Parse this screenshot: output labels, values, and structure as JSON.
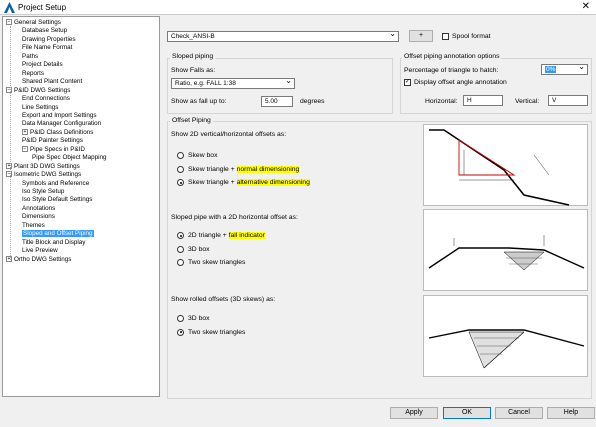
{
  "window": {
    "title": "Project Setup",
    "close_glyph": "✕",
    "app_icon": "autocad-a-icon"
  },
  "tree": [
    {
      "label": "General Settings",
      "exp": "−"
    },
    {
      "label": "Database Setup"
    },
    {
      "label": "Drawing Properties"
    },
    {
      "label": "File Name Format"
    },
    {
      "label": "Paths"
    },
    {
      "label": "Project Details"
    },
    {
      "label": "Reports"
    },
    {
      "label": "Shared Plant Content"
    },
    {
      "label": "P&ID DWG Settings",
      "exp": "−"
    },
    {
      "label": "End Connections"
    },
    {
      "label": "Line Settings"
    },
    {
      "label": "Export and Import Settings"
    },
    {
      "label": "Data Manager Configuration"
    },
    {
      "label": "P&ID Class Definitions",
      "exp": "+"
    },
    {
      "label": "P&ID Painter Settings"
    },
    {
      "label": "Pipe Specs in P&ID",
      "exp": "−"
    },
    {
      "label": "Pipe Spec Object Mapping"
    },
    {
      "label": "Plant 3D DWG Settings",
      "exp": "+"
    },
    {
      "label": "Isometric DWG Settings",
      "exp": "−"
    },
    {
      "label": "Symbols and Reference"
    },
    {
      "label": "Iso Style Setup"
    },
    {
      "label": "Iso Style Default Settings"
    },
    {
      "label": "Annotations"
    },
    {
      "label": "Dimensions"
    },
    {
      "label": "Themes"
    },
    {
      "label": "Sloped and Offset Piping",
      "selected": true
    },
    {
      "label": "Title Block and Display"
    },
    {
      "label": "Live Preview"
    },
    {
      "label": "Ortho DWG Settings",
      "exp": "+"
    }
  ],
  "style_select": {
    "value": "Check_ANSI-B",
    "add_label": "+",
    "spool_format_label": "Spool format"
  },
  "sloped": {
    "group_label": "Sloped piping",
    "show_falls_label": "Show Falls as:",
    "falls_value": "Ratio, e.g. FALL 1:38",
    "fall_up_label": "Show as fall up to:",
    "fall_up_value": "5.00",
    "degrees_label": "degrees"
  },
  "offset_annot": {
    "group_label": "Offset piping annotation options",
    "pct_label": "Percentage of triangle to hatch:",
    "pct_value": "0%",
    "display_angle_label": "Display offset angle annotation",
    "horizontal_label": "Horizontal:",
    "horizontal_value": "H",
    "vertical_label": "Vertical:",
    "vertical_value": "V"
  },
  "offset": {
    "group_label": "Offset Piping",
    "vh_label": "Show 2D vertical/horizontal offsets as:",
    "vh_options": [
      {
        "text": "Skew box",
        "hl": ""
      },
      {
        "text": "Skew triangle + ",
        "hl": "normal dimensioning"
      },
      {
        "text": "Skew triangle + ",
        "hl": "alternative dimensioning"
      }
    ],
    "sloped_label": "Sloped pipe with a 2D horizontal offset as:",
    "sloped_options": [
      {
        "text": "2D triangle + ",
        "hl": "fall indicator"
      },
      {
        "text": "3D box",
        "hl": ""
      },
      {
        "text": "Two skew triangles",
        "hl": ""
      }
    ],
    "rolled_label": "Show rolled offsets (3D skews) as:",
    "rolled_options": [
      {
        "text": "3D box",
        "hl": ""
      },
      {
        "text": "Two skew triangles",
        "hl": ""
      }
    ]
  },
  "buttons": {
    "apply": "Apply",
    "ok": "OK",
    "cancel": "Cancel",
    "help": "Help"
  },
  "colors": {
    "selection": "#3399ff",
    "highlight": "#ffff00",
    "accent": "#0078d7",
    "preview_red": "#cc0000"
  }
}
